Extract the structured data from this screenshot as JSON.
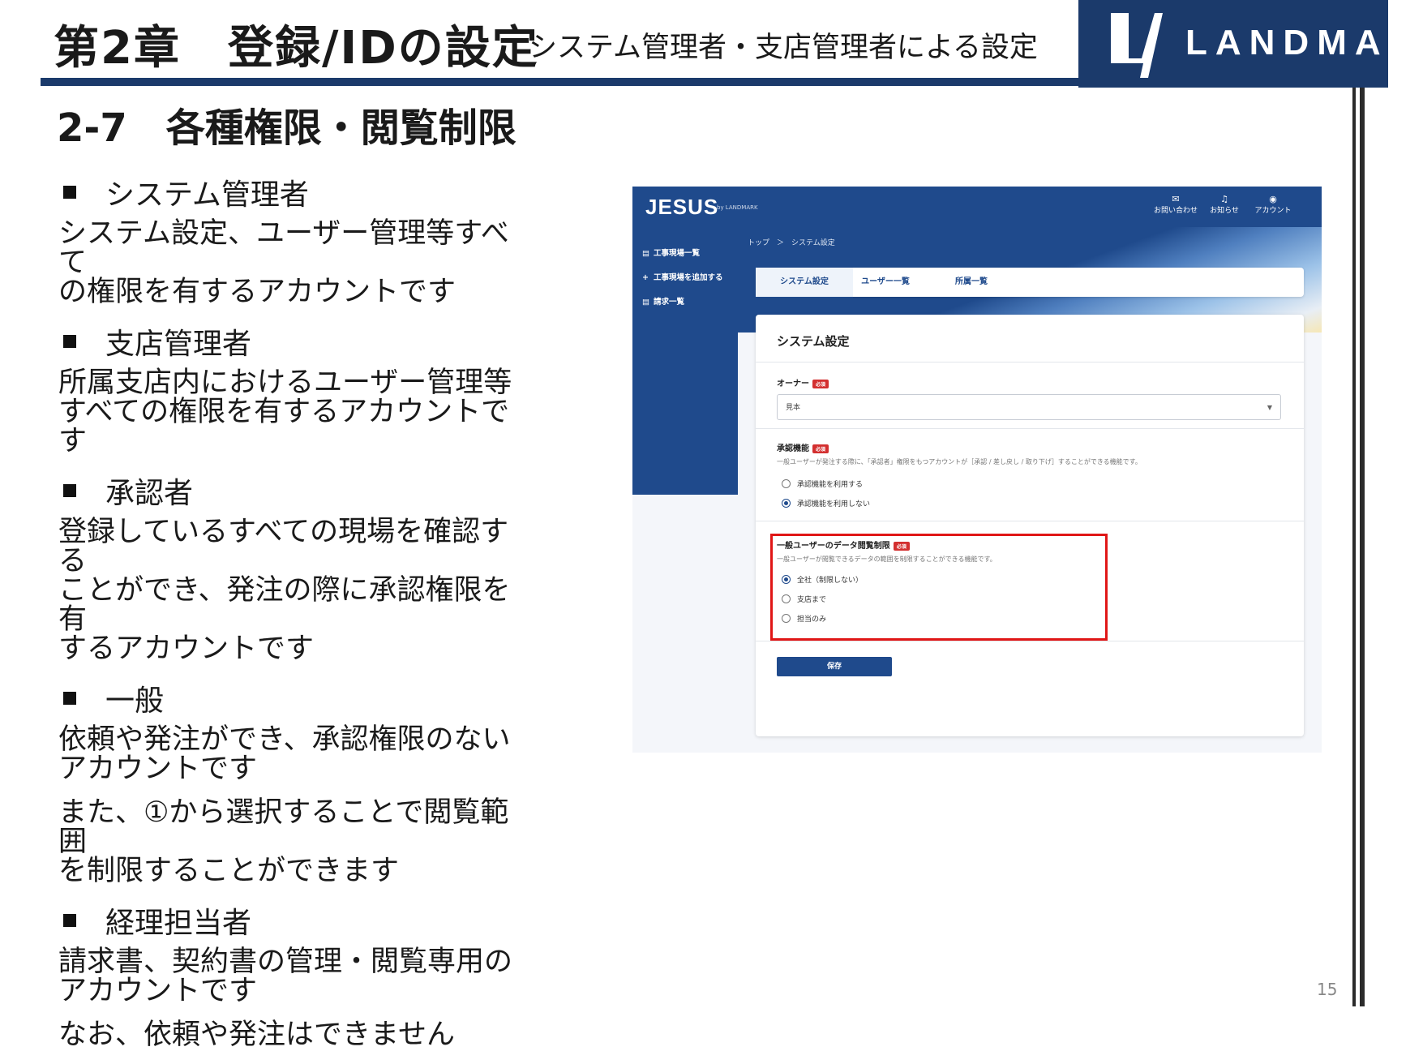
{
  "header": {
    "chapter_title": "第2章　登録/IDの設定",
    "chapter_subtitle": "システム管理者・支店管理者による設定",
    "logo_text": "LANDMARK"
  },
  "section_title": "2-7　各種権限・閲覧制限",
  "roles": [
    {
      "name": "システム管理者",
      "desc": [
        "システム設定、ユーザー管理等すべて",
        "の権限を有するアカウントです"
      ]
    },
    {
      "name": "支店管理者",
      "desc": [
        "所属支店内におけるユーザー管理等",
        "すべての権限を有するアカウントです"
      ]
    },
    {
      "name": "承認者",
      "desc": [
        "登録しているすべての現場を確認する",
        "ことができ、発注の際に承認権限を有",
        "するアカウントです"
      ]
    },
    {
      "name": "一般",
      "desc": [
        "依頼や発注ができ、承認権限のない",
        "アカウントです"
      ],
      "note": [
        "また、①から選択することで閲覧範囲",
        "を制限することができます"
      ]
    },
    {
      "name": "経理担当者",
      "desc": [
        "請求書、契約書の管理・閲覧専用の",
        "アカウントです"
      ],
      "note": [
        "なお、依頼や発注はできません"
      ]
    }
  ],
  "page_number": "15",
  "marker": "①",
  "screenshot": {
    "app_logo": "JESUS",
    "app_logo_small": "by LANDMARK",
    "topnav": [
      {
        "icon": "mail-icon",
        "glyph": "✉",
        "label": "お問い合わせ"
      },
      {
        "icon": "bell-icon",
        "glyph": "♫",
        "label": "お知らせ"
      },
      {
        "icon": "account-icon",
        "glyph": "◉",
        "label": "アカウント"
      }
    ],
    "sidebar": [
      {
        "icon": "list-icon",
        "glyph": "▤",
        "label": "工事現場一覧"
      },
      {
        "icon": "plus-icon",
        "glyph": "+",
        "label": "工事現場を追加する"
      },
      {
        "icon": "invoice-icon",
        "glyph": "▤",
        "label": "請求一覧"
      }
    ],
    "breadcrumb": "トップ　＞　システム設定",
    "tabs": [
      "システム設定",
      "ユーザー一覧",
      "所属一覧"
    ],
    "card_title": "システム設定",
    "owner_label": "オーナー",
    "required": "必須",
    "owner_value": "見本",
    "approval_label": "承認機能",
    "approval_help": "一般ユーザーが発注する際に、「承認者」権限をもつアカウントが［承認 / 差し戻し / 取り下げ］することができる機能です。",
    "approval_options": [
      "承認機能を利用する",
      "承認機能を利用しない"
    ],
    "approval_selected": 1,
    "restrict_label": "一般ユーザーのデータ閲覧制限",
    "restrict_help": "一般ユーザーが閲覧できるデータの範囲を制限することができる機能です。",
    "restrict_options": [
      "全社（制限しない）",
      "支店まで",
      "担当のみ"
    ],
    "restrict_selected": 0,
    "save_label": "保存"
  }
}
